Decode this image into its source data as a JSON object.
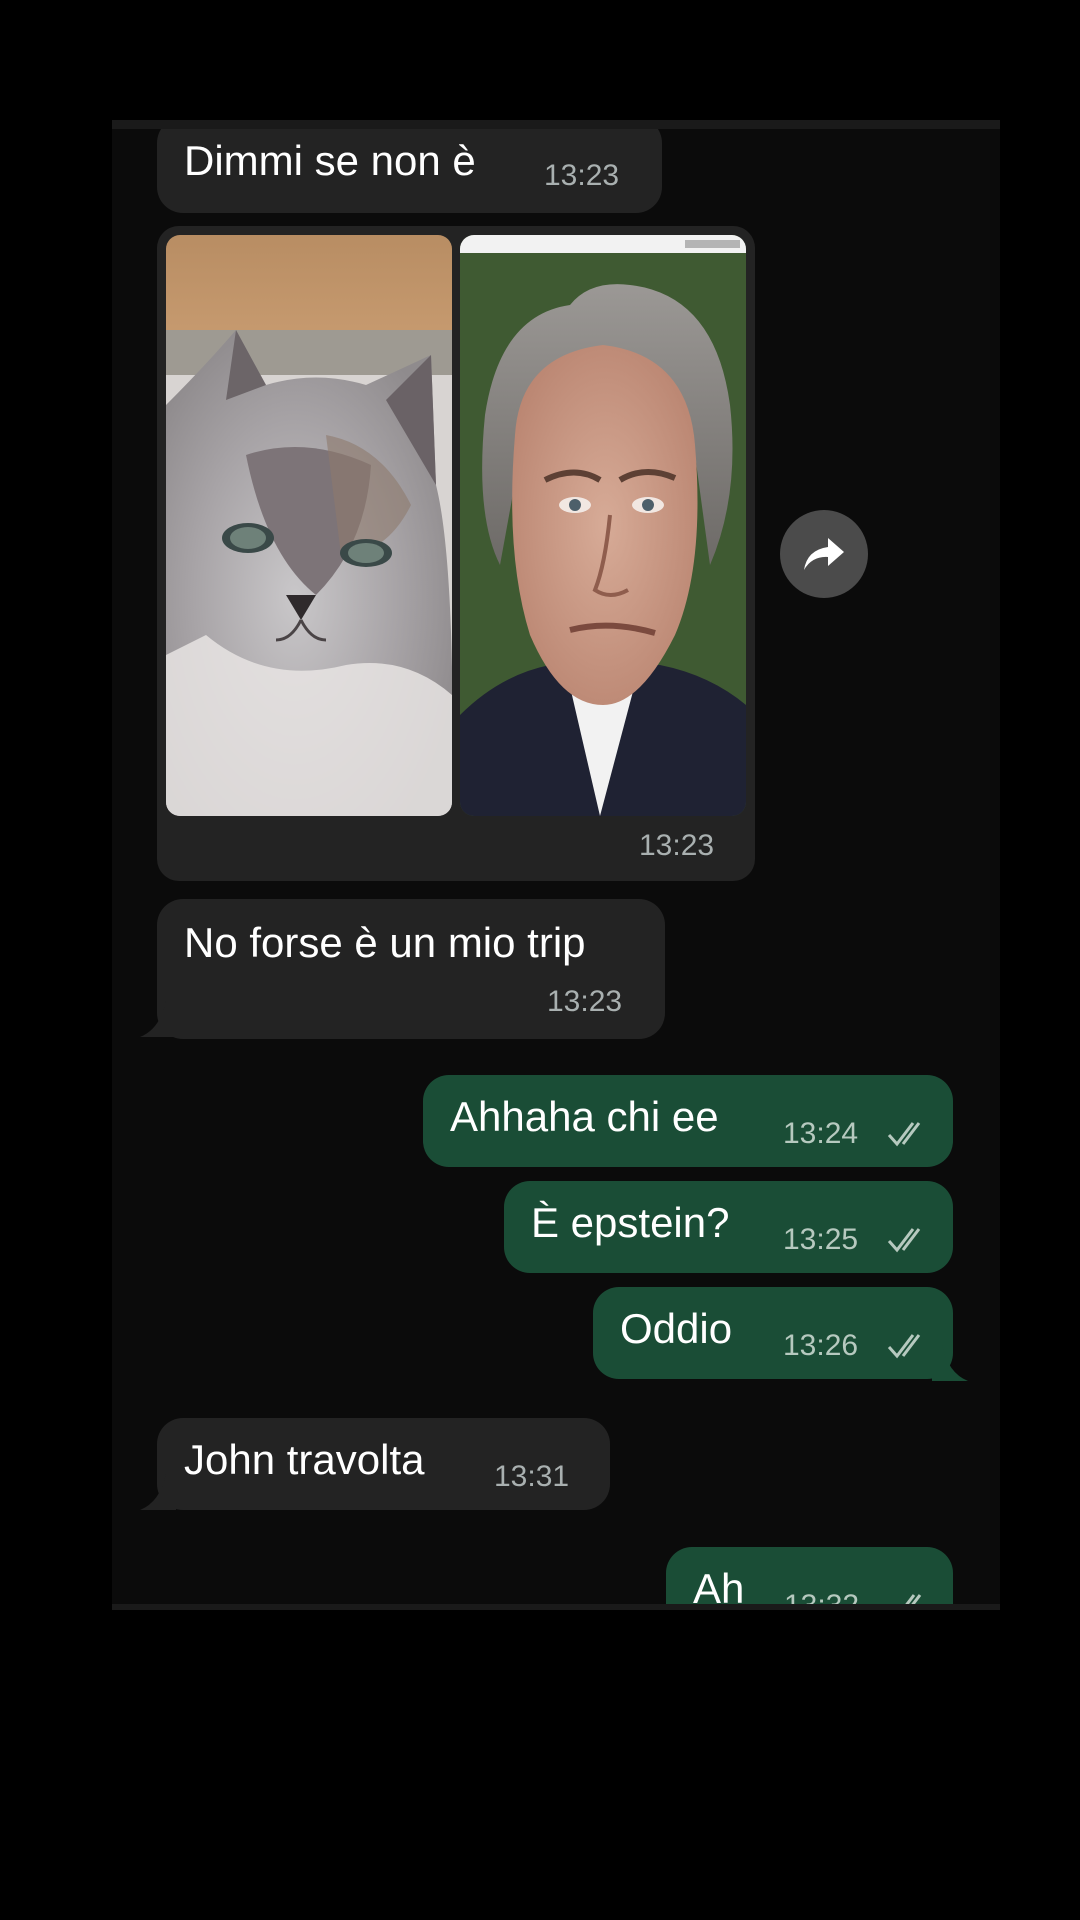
{
  "messages": [
    {
      "type": "incoming",
      "text": "Dimmi se non è",
      "time": "13:23"
    },
    {
      "type": "incoming-media",
      "time": "13:23",
      "images": [
        "cat-photo",
        "man-portrait"
      ]
    },
    {
      "type": "incoming",
      "text": "No forse è un mio trip",
      "time": "13:23"
    },
    {
      "type": "outgoing",
      "text": "Ahhaha chi ee",
      "time": "13:24",
      "status": "read"
    },
    {
      "type": "outgoing",
      "text": "È epstein?",
      "time": "13:25",
      "status": "read"
    },
    {
      "type": "outgoing",
      "text": "Oddio",
      "time": "13:26",
      "status": "read"
    },
    {
      "type": "incoming",
      "text": "John travolta",
      "time": "13:31"
    },
    {
      "type": "outgoing",
      "text": "Ah",
      "time": "13:32",
      "status": "read"
    }
  ],
  "icons": {
    "forward": "forward-arrow-icon",
    "read": "double-check-icon"
  },
  "colors": {
    "background": "#0b0b0b",
    "incoming_bubble": "#232323",
    "outgoing_bubble": "#1a4d36",
    "text": "#ffffff",
    "time": "#a9b0b0"
  }
}
